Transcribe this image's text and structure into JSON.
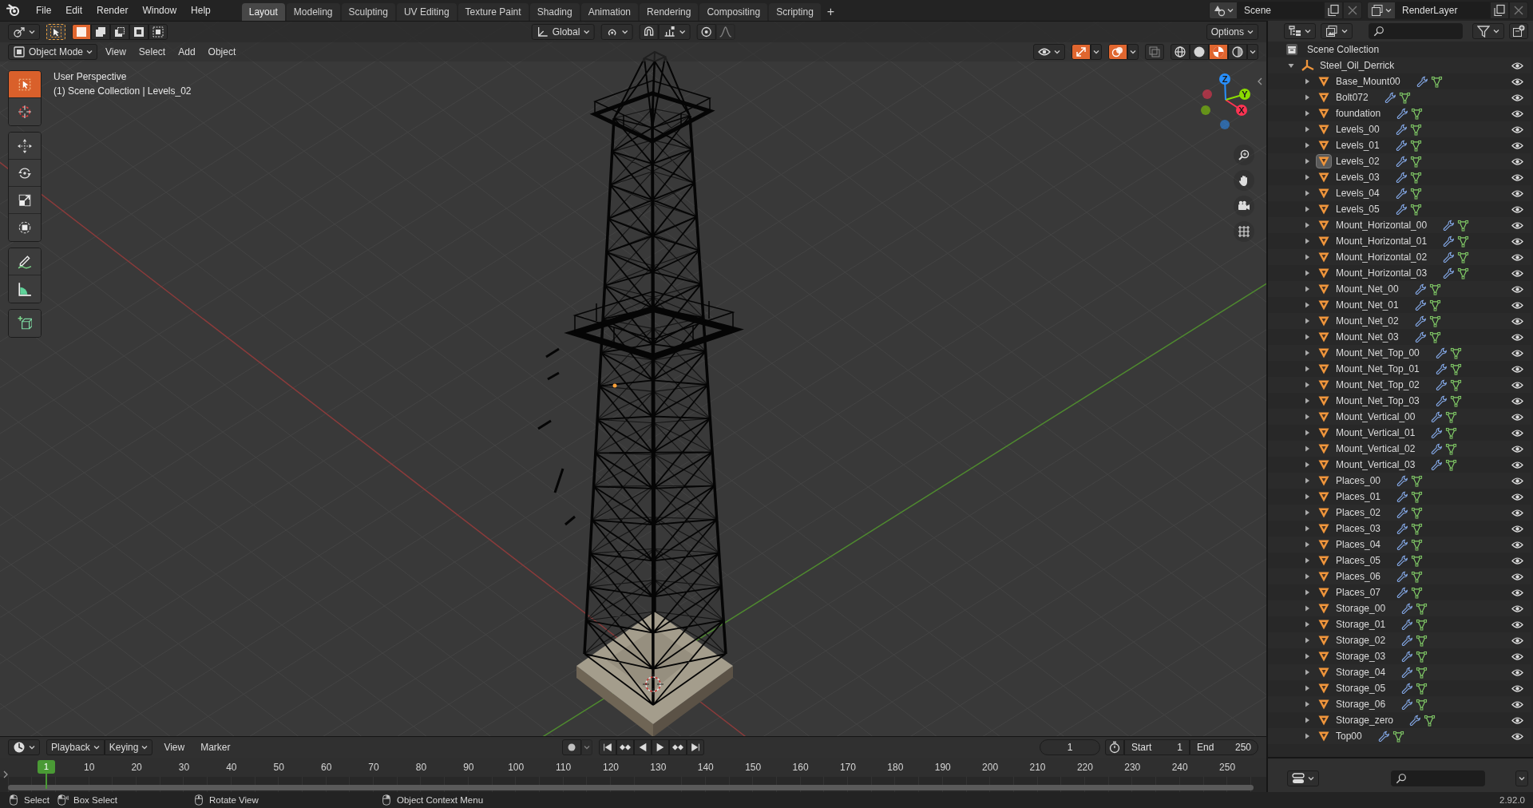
{
  "menu_bar": {
    "menus": [
      "File",
      "Edit",
      "Render",
      "Window",
      "Help"
    ],
    "workspace_tabs": [
      {
        "label": "Layout",
        "selected": true
      },
      {
        "label": "Modeling",
        "selected": false
      },
      {
        "label": "Sculpting",
        "selected": false
      },
      {
        "label": "UV Editing",
        "selected": false
      },
      {
        "label": "Texture Paint",
        "selected": false
      },
      {
        "label": "Shading",
        "selected": false
      },
      {
        "label": "Animation",
        "selected": false
      },
      {
        "label": "Rendering",
        "selected": false
      },
      {
        "label": "Compositing",
        "selected": false
      },
      {
        "label": "Scripting",
        "selected": false
      }
    ],
    "add_tab": "+",
    "scene": "Scene",
    "view_layer": "RenderLayer"
  },
  "tool_header": {
    "selection_modes": [
      {
        "kind": "set",
        "selected": true
      },
      {
        "kind": "extend",
        "selected": false
      },
      {
        "kind": "subtract",
        "selected": false
      },
      {
        "kind": "difference",
        "selected": false
      },
      {
        "kind": "intersect",
        "selected": false
      }
    ],
    "orientation": "Global",
    "options": "Options"
  },
  "viewport_header": {
    "mode": "Object Mode",
    "menus": [
      "View",
      "Select",
      "Add",
      "Object"
    ],
    "toggles": [
      {
        "kind": "gizmos",
        "on": true
      },
      {
        "kind": "overlays",
        "on": true
      },
      {
        "kind": "xray",
        "on": false
      }
    ],
    "shading": [
      {
        "kind": "wireframe",
        "selected": false
      },
      {
        "kind": "solid",
        "selected": false
      },
      {
        "kind": "material",
        "selected": true
      },
      {
        "kind": "rendered",
        "selected": false
      }
    ]
  },
  "viewport": {
    "view_name": "User Perspective",
    "context": "(1) Scene Collection | Levels_02",
    "tool_groups": [
      [
        {
          "kind": "select_box",
          "selected": true
        },
        {
          "kind": "cursor",
          "selected": false
        }
      ],
      [
        {
          "kind": "move",
          "selected": false
        },
        {
          "kind": "rotate",
          "selected": false
        },
        {
          "kind": "scale",
          "selected": false
        },
        {
          "kind": "transform",
          "selected": false
        }
      ],
      [
        {
          "kind": "annotate",
          "selected": false
        },
        {
          "kind": "measure",
          "selected": false
        }
      ],
      [
        {
          "kind": "add_cube",
          "selected": false
        }
      ]
    ],
    "gizmo_axes": [
      {
        "label": "X",
        "color": "#ff3352"
      },
      {
        "label": "Y",
        "color": "#8bdc00"
      },
      {
        "label": "Z",
        "color": "#2890ff"
      }
    ],
    "nav_buttons": [
      {
        "kind": "zoom"
      },
      {
        "kind": "pan"
      },
      {
        "kind": "camera"
      },
      {
        "kind": "ortho"
      }
    ]
  },
  "outliner": {
    "root": "Scene Collection",
    "tree": [
      {
        "name": "Steel_Oil_Derrick",
        "kind": "empty",
        "expanded": true,
        "selected": false,
        "children": [
          {
            "name": "Base_Mount00",
            "kind": "mesh",
            "expanded": false,
            "selected": false
          },
          {
            "name": "Bolt072",
            "kind": "mesh",
            "expanded": false,
            "selected": false
          },
          {
            "name": "foundation",
            "kind": "mesh",
            "expanded": false,
            "selected": false
          },
          {
            "name": "Levels_00",
            "kind": "mesh",
            "expanded": false,
            "selected": false
          },
          {
            "name": "Levels_01",
            "kind": "mesh",
            "expanded": false,
            "selected": false
          },
          {
            "name": "Levels_02",
            "kind": "mesh",
            "expanded": false,
            "selected": true
          },
          {
            "name": "Levels_03",
            "kind": "mesh",
            "expanded": false,
            "selected": false
          },
          {
            "name": "Levels_04",
            "kind": "mesh",
            "expanded": false,
            "selected": false
          },
          {
            "name": "Levels_05",
            "kind": "mesh",
            "expanded": false,
            "selected": false
          },
          {
            "name": "Mount_Horizontal_00",
            "kind": "mesh",
            "expanded": false,
            "selected": false
          },
          {
            "name": "Mount_Horizontal_01",
            "kind": "mesh",
            "expanded": false,
            "selected": false
          },
          {
            "name": "Mount_Horizontal_02",
            "kind": "mesh",
            "expanded": false,
            "selected": false
          },
          {
            "name": "Mount_Horizontal_03",
            "kind": "mesh",
            "expanded": false,
            "selected": false
          },
          {
            "name": "Mount_Net_00",
            "kind": "mesh",
            "expanded": false,
            "selected": false
          },
          {
            "name": "Mount_Net_01",
            "kind": "mesh",
            "expanded": false,
            "selected": false
          },
          {
            "name": "Mount_Net_02",
            "kind": "mesh",
            "expanded": false,
            "selected": false
          },
          {
            "name": "Mount_Net_03",
            "kind": "mesh",
            "expanded": false,
            "selected": false
          },
          {
            "name": "Mount_Net_Top_00",
            "kind": "mesh",
            "expanded": false,
            "selected": false
          },
          {
            "name": "Mount_Net_Top_01",
            "kind": "mesh",
            "expanded": false,
            "selected": false
          },
          {
            "name": "Mount_Net_Top_02",
            "kind": "mesh",
            "expanded": false,
            "selected": false
          },
          {
            "name": "Mount_Net_Top_03",
            "kind": "mesh",
            "expanded": false,
            "selected": false
          },
          {
            "name": "Mount_Vertical_00",
            "kind": "mesh",
            "expanded": false,
            "selected": false
          },
          {
            "name": "Mount_Vertical_01",
            "kind": "mesh",
            "expanded": false,
            "selected": false
          },
          {
            "name": "Mount_Vertical_02",
            "kind": "mesh",
            "expanded": false,
            "selected": false
          },
          {
            "name": "Mount_Vertical_03",
            "kind": "mesh",
            "expanded": false,
            "selected": false
          },
          {
            "name": "Places_00",
            "kind": "mesh",
            "expanded": false,
            "selected": false
          },
          {
            "name": "Places_01",
            "kind": "mesh",
            "expanded": false,
            "selected": false
          },
          {
            "name": "Places_02",
            "kind": "mesh",
            "expanded": false,
            "selected": false
          },
          {
            "name": "Places_03",
            "kind": "mesh",
            "expanded": false,
            "selected": false
          },
          {
            "name": "Places_04",
            "kind": "mesh",
            "expanded": false,
            "selected": false
          },
          {
            "name": "Places_05",
            "kind": "mesh",
            "expanded": false,
            "selected": false
          },
          {
            "name": "Places_06",
            "kind": "mesh",
            "expanded": false,
            "selected": false
          },
          {
            "name": "Places_07",
            "kind": "mesh",
            "expanded": false,
            "selected": false
          },
          {
            "name": "Storage_00",
            "kind": "mesh",
            "expanded": false,
            "selected": false
          },
          {
            "name": "Storage_01",
            "kind": "mesh",
            "expanded": false,
            "selected": false
          },
          {
            "name": "Storage_02",
            "kind": "mesh",
            "expanded": false,
            "selected": false
          },
          {
            "name": "Storage_03",
            "kind": "mesh",
            "expanded": false,
            "selected": false
          },
          {
            "name": "Storage_04",
            "kind": "mesh",
            "expanded": false,
            "selected": false
          },
          {
            "name": "Storage_05",
            "kind": "mesh",
            "expanded": false,
            "selected": false
          },
          {
            "name": "Storage_06",
            "kind": "mesh",
            "expanded": false,
            "selected": false
          },
          {
            "name": "Storage_zero",
            "kind": "mesh",
            "expanded": false,
            "selected": false
          },
          {
            "name": "Top00",
            "kind": "mesh",
            "expanded": false,
            "selected": false
          }
        ]
      }
    ]
  },
  "timeline": {
    "dropdowns": [
      "Playback",
      "Keying"
    ],
    "menus": [
      "View",
      "Marker"
    ],
    "auto_keying": false,
    "current_frame": "1",
    "range": [
      {
        "label": "Start",
        "value": "1"
      },
      {
        "label": "End",
        "value": "250"
      }
    ],
    "ruler": {
      "current": "1",
      "ticks": [
        "10",
        "20",
        "30",
        "40",
        "50",
        "60",
        "70",
        "80",
        "90",
        "100",
        "110",
        "120",
        "130",
        "140",
        "150",
        "160",
        "170",
        "180",
        "190",
        "200",
        "210",
        "220",
        "230",
        "240",
        "250"
      ]
    }
  },
  "status_bar": {
    "hints": [
      {
        "kind": "left_click",
        "label": "Select"
      },
      {
        "kind": "left_drag",
        "label": "Box Select"
      },
      {
        "kind": "middle_drag",
        "label": "Rotate View"
      },
      {
        "kind": "right_click",
        "label": "Object Context Menu"
      }
    ],
    "version": "2.92.0"
  }
}
